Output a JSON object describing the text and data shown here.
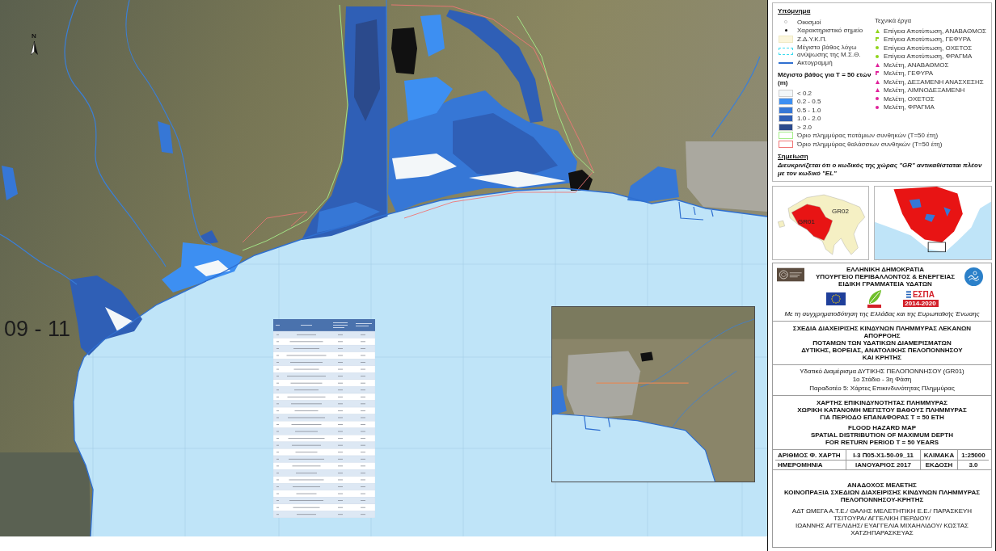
{
  "map": {
    "north_label": "N",
    "sheet_number": "09 - 11"
  },
  "legend": {
    "title": "Υπόμνημα",
    "symbols": [
      {
        "kind": "hollow-dot",
        "label": "Οικισμοί"
      },
      {
        "kind": "dot",
        "label": "Χαρακτηριστικό σημείο"
      },
      {
        "kind": "swatch",
        "color": "#fbf6dc",
        "label": "Ζ.Δ.Υ.Κ.Π."
      },
      {
        "kind": "dashed-swatch",
        "color": "#3fdcef",
        "label": "Μέγιστο βάθος λόγω ανύψωσης της Μ.Σ.Θ."
      },
      {
        "kind": "line",
        "color": "#2f6fd0",
        "label": "Ακτογραμμή"
      }
    ],
    "depth_title": "Μέγιστο βάθος για Τ = 50 ετών (m)",
    "depth_classes": [
      {
        "label": "< 0.2",
        "color": "#f3f7f9"
      },
      {
        "label": "0.2 - 0.5",
        "color": "#3d8ff2"
      },
      {
        "label": "0.5 - 1.0",
        "color": "#3677d6"
      },
      {
        "label": "1.0 - 2.0",
        "color": "#2f5fb6"
      },
      {
        "label": "> 2.0",
        "color": "#2b4a8c"
      }
    ],
    "boundaries": [
      {
        "label": "Όριο πλημμύρας ποτάμιων συνθηκών (Τ=50 έτη)",
        "color": "#a6ee8a"
      },
      {
        "label": "Όριο πλημμύρας θαλάσσιων συνθηκών (Τ=50 έτη)",
        "color": "#f07676"
      }
    ],
    "works_title": "Τεχνικά έργα",
    "works": [
      {
        "kind": "triangle",
        "color": "#8fd41a",
        "label": "Επίγεια Αποτύπωση, ΑΝΑΒΑΘΜΟΣ"
      },
      {
        "kind": "flag",
        "color": "#8fd41a",
        "label": "Επίγεια Αποτύπωση, ΓΕΦΥΡΑ"
      },
      {
        "kind": "dot",
        "color": "#8fd41a",
        "label": "Επίγεια Αποτύπωση, ΟΧΕΤΟΣ"
      },
      {
        "kind": "dot",
        "color": "#8fd41a",
        "label": "Επίγεια Αποτύπωση, ΦΡΑΓΜΑ"
      },
      {
        "kind": "triangle",
        "color": "#e0209a",
        "label": "Μελέτη, ΑΝΑΒΑΘΜΟΣ"
      },
      {
        "kind": "flag",
        "color": "#e0209a",
        "label": "Μελέτη, ΓΕΦΥΡΑ"
      },
      {
        "kind": "triangle",
        "color": "#e0209a",
        "label": "Μελέτη, ΔΕΞΑΜΕΝΗ ΑΝΑΣΧΕΣΗΣ"
      },
      {
        "kind": "triangle",
        "color": "#e0209a",
        "label": "Μελέτη, ΛΙΜΝΟΔΕΞΑΜΕΝΗ"
      },
      {
        "kind": "dot",
        "color": "#e0209a",
        "label": "Μελέτη, ΟΧΕΤΟΣ"
      },
      {
        "kind": "dot",
        "color": "#e0209a",
        "label": "Μελέτη, ΦΡΑΓΜΑ"
      }
    ],
    "note_title": "Σημείωση",
    "note": "Διευκρινίζεται ότι ο κωδικός της χώρας \"GR\" αντικαθίσταται πλέον με τον κωδικό \"EL\""
  },
  "locator_maps": {
    "overview_labels": [
      "GR02",
      "GR01"
    ]
  },
  "title_block": {
    "authority": [
      "ΕΛΛΗΝΙΚΗ ΔΗΜΟΚΡΑΤΙΑ",
      "ΥΠΟΥΡΓΕΙΟ ΠΕΡΙΒΑΛΛΟΝΤΟΣ & ΕΝΕΡΓΕΙΑΣ",
      "ΕΙΔΙΚΗ ΓΡΑΜΜΑΤΕΙΑ ΥΔΑΤΩΝ"
    ],
    "espa_logo": {
      "title": "ΕΣΠΑ",
      "years": "2014-2020"
    },
    "cofunding": "Με τη συγχρηματοδότηση της Ελλάδας και της Ευρωπαϊκής Ένωσης",
    "project": [
      "ΣΧΕΔΙΑ ΔΙΑΧΕΙΡΙΣΗΣ ΚΙΝΔΥΝΩΝ ΠΛΗΜΜΥΡΑΣ ΛΕΚΑΝΩΝ ΑΠΟΡΡΟΗΣ",
      "ΠΟΤΑΜΩΝ ΤΩΝ ΥΔΑΤΙΚΩΝ ΔΙΑΜΕΡΙΣΜΑΤΩΝ",
      "ΔΥΤΙΚΗΣ, ΒΟΡΕΙΑΣ, ΑΝΑΤΟΛΙΚΗΣ ΠΕΛΟΠΟΝΝΗΣΟΥ",
      "ΚΑΙ ΚΡΗΤΗΣ"
    ],
    "phase": [
      "Υδατικό Διαμέρισμα ΔΥΤΙΚΗΣ ΠΕΛΟΠΟΝΝΗΣΟΥ (GR01)",
      "1ο Στάδιο - 3η Φάση",
      "Παραδοτέο 5: Χάρτες Επικινδυνότητας Πλημμύρας"
    ],
    "map_title_el": [
      "ΧΑΡΤΗΣ ΕΠΙΚΙΝΔΥΝΟΤΗΤΑΣ ΠΛΗΜΜΥΡΑΣ",
      "ΧΩΡΙΚΗ ΚΑΤΑΝΟΜΗ ΜΕΓΙΣΤΟΥ ΒΑΘΟΥΣ ΠΛΗΜΜΥΡΑΣ",
      "ΓΙΑ ΠΕΡΙΟΔΟ ΕΠΑΝΑΦΟΡΑΣ Τ = 50 ΕΤΗ"
    ],
    "map_title_en": [
      "FLOOD HAZARD MAP",
      "SPATIAL DISTRIBUTION OF MAXIMUM DEPTH",
      "FOR RETURN PERIOD T = 50 YEARS"
    ],
    "info_rows": [
      [
        "ΑΡΙΘΜΟΣ Φ. ΧΑΡΤΗ",
        "I-3 Π05-X1-50-09_11",
        "ΚΛΙΜΑΚΑ",
        "1:25000"
      ],
      [
        "ΗΜΕΡΟΜΗΝΙΑ",
        "ΙΑΝΟΥΑΡΙΟΣ 2017",
        "ΕΚΔΟΣΗ",
        "3.0"
      ]
    ],
    "contractor": [
      "ΑΝΑΔΟΧΟΣ ΜΕΛΕΤΗΣ",
      "ΚΟΙΝΟΠΡΑΞΙΑ ΣΧΕΔΙΩΝ ΔΙΑΧΕΙΡΙΣΗΣ ΚΙΝΔΥΝΩΝ ΠΛΗΜΜΥΡΑΣ",
      "ΠΕΛΟΠΟΝΝΗΣΟΥ-ΚΡΗΤΗΣ"
    ],
    "members": [
      "ΑΔΤ ΩΜΕΓΑ Α.Τ.Ε./ ΘΑΛΗΣ ΜΕΛΕΤΗΤΙΚΗ Ε.Ε./ ΠΑΡΑΣΚΕΥΗ ΤΣΙΤΟΥΡΑ/ ΑΓΓΕΛΙΚΗ ΠΕΡΔΙΟΥ/",
      "ΙΩΑΝΝΗΣ ΑΓΓΕΛΙΔΗΣ/ ΕΥΑΓΓΕΛΙΑ ΜΙΧΑΗΛΙΔΟΥ/ ΚΩΣΤΑΣ ΧΑΤΖΗΠΑΡΑΣΚΕΥΑΣ"
    ]
  }
}
